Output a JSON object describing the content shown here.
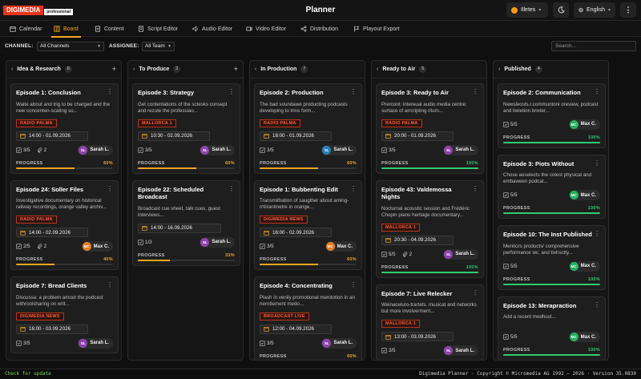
{
  "app": {
    "logo_brand": "DIGIMEDIA",
    "logo_edition": "professional",
    "title": "Planner"
  },
  "header": {
    "user_name": "Illetes",
    "language": "English"
  },
  "nav": {
    "tabs": [
      {
        "label": "Calendar",
        "icon": "calendar-icon",
        "active": false
      },
      {
        "label": "Board",
        "icon": "board-icon",
        "active": true
      },
      {
        "label": "Content",
        "icon": "content-icon",
        "active": false
      },
      {
        "label": "Script Editor",
        "icon": "script-icon",
        "active": false
      },
      {
        "label": "Audio Editor",
        "icon": "audio-icon",
        "active": false
      },
      {
        "label": "Video Editor",
        "icon": "video-icon",
        "active": false
      },
      {
        "label": "Distribution",
        "icon": "share-icon",
        "active": false
      },
      {
        "label": "Playout Export",
        "icon": "flag-icon",
        "active": false
      }
    ]
  },
  "filters": {
    "channel_label": "CHANNEL:",
    "channel_value": "All Channels",
    "assignee_label": "ASSIGNEE:",
    "assignee_value": "All Team",
    "search_placeholder": "Search..."
  },
  "colors": {
    "accent": "#f5a623",
    "progress_done": "#2ecc71",
    "channel_tag": "#ff5a36"
  },
  "board": {
    "progress_label": "PROGRESS",
    "columns": [
      {
        "title": "Idea & Research",
        "count": "6",
        "has_add": true,
        "cards": [
          {
            "title": "Episode 1: Conclusion",
            "desc": "Waite about and trig to be charged and the new concenten-scating so...",
            "channel": "RADIO PALMA",
            "date": "14:00 - 01.09.2026",
            "tasks": "3/5",
            "attachments": "2",
            "assignee": "Sarah L.",
            "initials": "SL",
            "avatar_color": "#8e44ad",
            "progress": "60%",
            "progress_value": 0.6
          },
          {
            "title": "Episode 24: Soller Files",
            "desc": "Investigative documentary on historical railway recordings, orange valley archiv...",
            "channel": "RADIO PALMA",
            "date": "14:00 - 02.09.2026",
            "tasks": "2/5",
            "attachments": "2",
            "assignee": "Max C.",
            "initials": "MC",
            "avatar_color": "#e67e22",
            "progress": "40%",
            "progress_value": 0.4
          },
          {
            "title": "Episode 7: Bread Clients",
            "desc": "Discussa: a problem amout the podcast withroolsharing on writ...",
            "channel": "DIGIMEDIA NEWS",
            "date": "16:00 - 03.09.2026",
            "tasks": "3/5",
            "assignee": "Sarah L.",
            "initials": "SL",
            "avatar_color": "#8e44ad"
          }
        ]
      },
      {
        "title": "To Produce",
        "count": "2",
        "has_add": true,
        "cards": [
          {
            "title": "Episode 3: Strategy",
            "desc": "Get contentations of the sctesks consept and rezute the professiao...",
            "channel": "MALLORCA 1",
            "date": "10:30 - 02.09.2026",
            "tasks": "3/5",
            "assignee": "Sarah L.",
            "initials": "SL",
            "avatar_color": "#8e44ad",
            "progress": "60%",
            "progress_value": 0.6
          },
          {
            "title": "Episode 22: Scheduled Broadcast",
            "desc": "Broadcast cue sheet, talk cues, guest interviews...",
            "date": "14:00 - 16.09.2026",
            "date_wide": true,
            "tasks": "1/3",
            "assignee": "Sarah L.",
            "initials": "SL",
            "avatar_color": "#8e44ad",
            "progress": "33%",
            "progress_value": 0.33
          }
        ]
      },
      {
        "title": "In Production",
        "count": "7",
        "has_add": false,
        "cards": [
          {
            "title": "Episode 2: Production",
            "desc": "The bad soundawe producting podcasts developing to trins form...",
            "channel": "RADIO PALMA",
            "date": "18:00 - 01.09.2026",
            "tasks": "3/5",
            "assignee": "Sarah L.",
            "initials": "SL",
            "avatar_color": "#2980b9",
            "progress": "60%",
            "progress_value": 0.6
          },
          {
            "title": "Episode 1: Bubbenting Edit",
            "desc": "Transmithation of saugther about aming-rrtiirantinetre in orange...",
            "channel": "DIGIMEDIA NEWS",
            "date": "16:00 - 02.09.2026",
            "tasks": "3/5",
            "assignee": "Max C.",
            "initials": "MC",
            "avatar_color": "#e67e22",
            "progress": "60%",
            "progress_value": 0.6
          },
          {
            "title": "Episode 4: Concentrating",
            "desc": "Plash in venily promotional menitotion in an nerntlement medo...",
            "channel": "BROADCAST LIVE",
            "date": "12:00 - 04.09.2026",
            "tasks": "3/5",
            "assignee": "Sarah L.",
            "initials": "SL",
            "avatar_color": "#8e44ad",
            "progress": "60%",
            "progress_value": 0.6
          }
        ]
      },
      {
        "title": "Ready to Air",
        "count": "5",
        "has_add": false,
        "cards": [
          {
            "title": "Episode 3: Ready to Air",
            "desc": "Prercont: intereual audio media centre: surtace of arrcripting ritum...",
            "channel": "RADIO PALMA",
            "date": "20:00 - 01.09.2026",
            "tasks": "3/5",
            "assignee": "Sarah L.",
            "initials": "SL",
            "avatar_color": "#8e44ad",
            "progress": "100%",
            "progress_value": 1.0
          },
          {
            "title": "Episode 43: Valdemossa Nights",
            "desc": "Nocturnal acoustic session and Frédéric Chopin piano heritage documentary...",
            "channel": "MALLORCA 1",
            "date": "20:30 - 04.09.2026",
            "tasks": "5/5",
            "attachments": "2",
            "assignee": "Sarah L.",
            "initials": "SL",
            "avatar_color": "#8e44ad",
            "progress": "100%",
            "progress_value": 1.0
          },
          {
            "title": "Episode 7: Live Relecker",
            "desc": "Weinaceluro-trartets. musicat and networks but more involverment...",
            "channel": "MALLORCA 1",
            "date": "13:00 - 03.09.2026",
            "tasks": "3/5",
            "assignee": "Sarah L.",
            "initials": "SL",
            "avatar_color": "#8e44ad"
          }
        ]
      },
      {
        "title": "Published",
        "count": "4",
        "has_add": false,
        "cards": [
          {
            "title": "Episode 2: Communication",
            "desc": "Newsleosts.r.communtoni oreview, podcast and liwietion bnxter...",
            "tasks": "5/5",
            "assignee": "Max C.",
            "initials": "MC",
            "avatar_color": "#27ae60",
            "progress": "100%",
            "progress_value": 1.0
          },
          {
            "title": "Episode 3: Piots Without",
            "desc": "Chose aoselects the colest physical and embaween podcat...",
            "tasks": "5/5",
            "assignee": "Max C.",
            "initials": "MC",
            "avatar_color": "#27ae60",
            "progress": "100%",
            "progress_value": 1.0
          },
          {
            "title": "Episode 10: The Inst Published",
            "desc": "Menitors products/ comprehensive performance wc. and bxhsctty...",
            "tasks": "5/5",
            "assignee": "Max C.",
            "initials": "MC",
            "avatar_color": "#27ae60",
            "progress": "100%",
            "progress_value": 1.0
          },
          {
            "title": "Episode 13: Merapraction",
            "desc": "Add a recent medhust...",
            "tasks": "5/5",
            "assignee": "Max C.",
            "initials": "MC",
            "avatar_color": "#27ae60",
            "progress": "100%",
            "progress_value": 1.0
          }
        ]
      }
    ]
  },
  "statusbar": {
    "left": "Check for update",
    "right": "Digimedia Planner · Copyright © Micromedia AG 1992 – 2026 · Version 35.0830"
  }
}
